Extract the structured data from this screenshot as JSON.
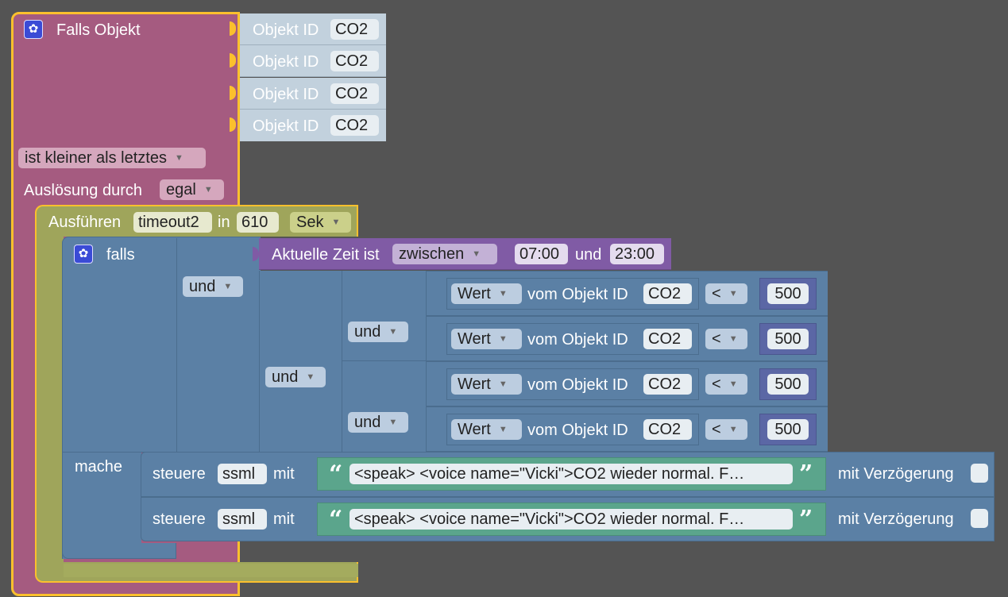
{
  "trigger": {
    "title": "Falls Objekt",
    "object_id_label": "Objekt ID",
    "object_ids": [
      "CO2",
      "CO2",
      "CO2",
      "CO2"
    ],
    "condition": "ist kleiner als letztes",
    "trigger_by_label": "Auslösung durch",
    "trigger_by_value": "egal"
  },
  "timeout": {
    "label": "Ausführen",
    "name": "timeout2",
    "in_label": "in",
    "duration": "610",
    "unit": "Sek"
  },
  "if_block": {
    "label": "falls",
    "do_label": "mache",
    "and_label": "und",
    "time": {
      "label": "Aktuelle Zeit ist",
      "mode": "zwischen",
      "from": "07:00",
      "and_label": "und",
      "to": "23:00"
    },
    "comparisons": [
      {
        "prop": "Wert",
        "text": "vom Objekt ID",
        "id": "CO2",
        "op": "<",
        "value": "500"
      },
      {
        "prop": "Wert",
        "text": "vom Objekt ID",
        "id": "CO2",
        "op": "<",
        "value": "500"
      },
      {
        "prop": "Wert",
        "text": "vom Objekt ID",
        "id": "CO2",
        "op": "<",
        "value": "500"
      },
      {
        "prop": "Wert",
        "text": "vom Objekt ID",
        "id": "CO2",
        "op": "<",
        "value": "500"
      }
    ]
  },
  "actions": [
    {
      "label": "steuere",
      "target": "ssml",
      "with_label": "mit",
      "text": "<speak> <voice name=\"Vicki\">CO2 wieder normal. F…",
      "delay_label": "mit Verzögerung"
    },
    {
      "label": "steuere",
      "target": "ssml",
      "with_label": "mit",
      "text": "<speak> <voice name=\"Vicki\">CO2 wieder normal. F…",
      "delay_label": "mit Verzögerung"
    }
  ],
  "colors": {
    "trigger": "#a55b80",
    "timeout": "#9fa55b",
    "logic": "#5b80a5",
    "time": "#805ba5",
    "text": "#5ba58c",
    "object": "#c2d1dd",
    "highlight": "#fbc02d"
  }
}
